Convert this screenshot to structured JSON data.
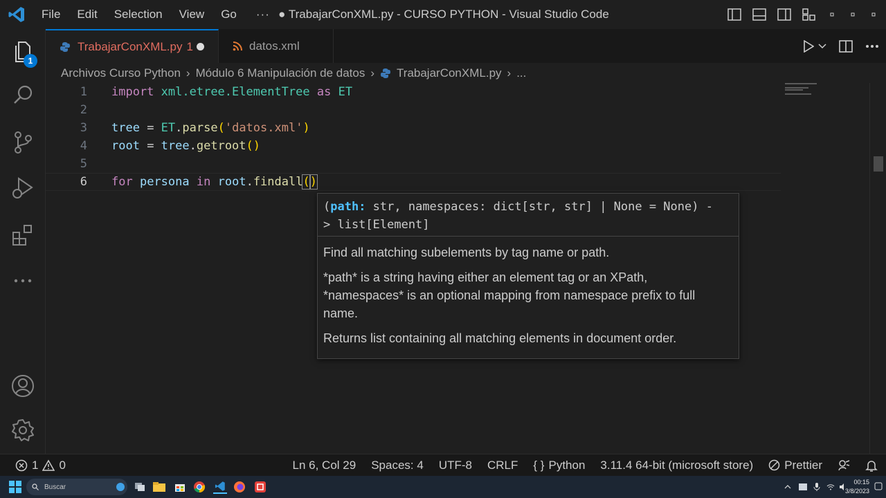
{
  "titlebar": {
    "menu": [
      "File",
      "Edit",
      "Selection",
      "View",
      "Go"
    ],
    "more": "···",
    "title": "● TrabajarConXML.py - CURSO PYTHON - Visual Studio Code"
  },
  "activity": {
    "explorer_badge": "1"
  },
  "tabs": [
    {
      "label": "TrabajarConXML.py",
      "problems": "1",
      "icon": "python-icon",
      "modified": true
    },
    {
      "label": "datos.xml",
      "icon": "rss-icon"
    }
  ],
  "breadcrumb": [
    "Archivos Curso Python",
    "Módulo 6 Manipulación de datos",
    "TrabajarConXML.py",
    "..."
  ],
  "code": {
    "line_numbers": [
      "1",
      "2",
      "3",
      "4",
      "5",
      "6"
    ],
    "l1": {
      "kw": "import",
      "mod": "xml.etree.ElementTree",
      "as": "as",
      "alias": "ET"
    },
    "l3": {
      "var": "tree",
      "eq": " = ",
      "cls": "ET",
      "dot": ".",
      "fn": "parse",
      "open": "(",
      "str": "'datos.xml'",
      "close": ")"
    },
    "l4": {
      "var": "root",
      "eq": " = ",
      "obj": "tree",
      "dot": ".",
      "fn": "getroot",
      "parens": "()"
    },
    "l6": {
      "for": "for",
      "var": "persona",
      "in": "in",
      "obj": "root",
      "dot": ".",
      "fn": "findall",
      "open": "(",
      "close": ")"
    }
  },
  "hover": {
    "sig_open": "(",
    "sig_param": "path:",
    "sig_rest1": " str, namespaces: dict[str, str] | None = None) -",
    "sig_rest2": "> list[Element]",
    "doc1": "Find all matching subelements by tag name or path.",
    "doc2a": "*path* is a string having either an element tag or an XPath,",
    "doc2b": "*namespaces* is an optional mapping from namespace prefix to full",
    "doc2c": "name.",
    "doc3": "Returns list containing all matching elements in document order."
  },
  "status": {
    "errors": "1",
    "warnings": "0",
    "position": "Ln 6, Col 29",
    "spaces": "Spaces: 4",
    "encoding": "UTF-8",
    "eol": "CRLF",
    "language": "Python",
    "interpreter": "3.11.4 64-bit (microsoft store)",
    "formatter": "Prettier"
  },
  "taskbar": {
    "search": "Buscar",
    "time": "00:15",
    "date": "3/8/2023"
  },
  "colors": {
    "accent": "#0078d4",
    "modified_tab": "#e06c5f",
    "keyword": "#569cd6",
    "variable": "#9cdcfe",
    "class": "#4ec9b0",
    "function": "#dcdcaa",
    "string": "#ce9178"
  }
}
